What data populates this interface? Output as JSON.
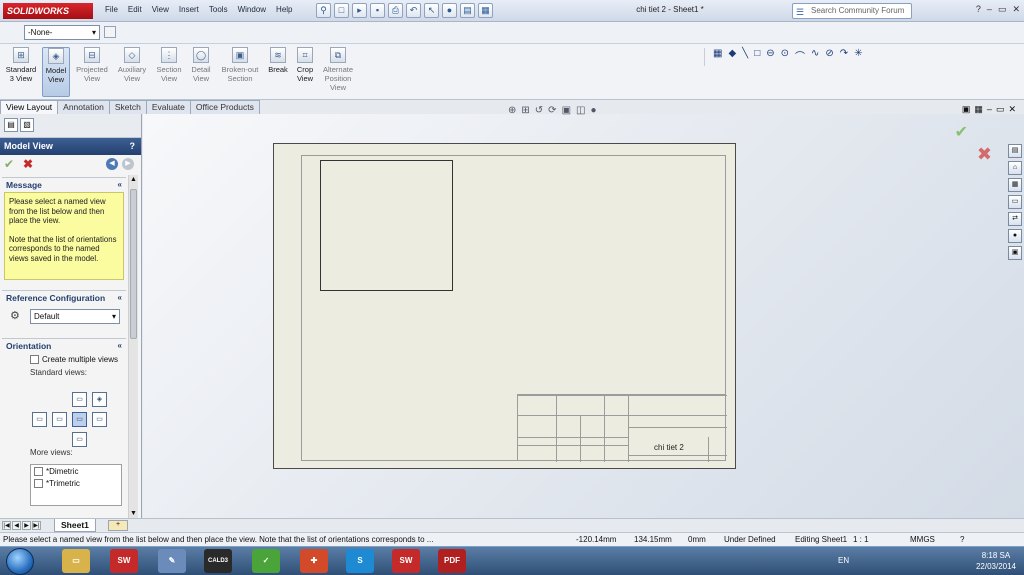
{
  "app": {
    "logo": "SOLIDWORKS",
    "title": "chi tiet 2 - Sheet1 *",
    "menu": [
      "File",
      "Edit",
      "View",
      "Insert",
      "Tools",
      "Window",
      "Help"
    ],
    "search_placeholder": "Search Community Forum",
    "window_controls": [
      "?",
      "–",
      "▭",
      "✕"
    ]
  },
  "config": {
    "value": "-None-"
  },
  "ribbon": {
    "buttons": [
      {
        "label": "Standard 3 View"
      },
      {
        "label": "Model View"
      },
      {
        "label": "Projected View"
      },
      {
        "label": "Auxiliary View"
      },
      {
        "label": "Section View"
      },
      {
        "label": "Detail View"
      },
      {
        "label": "Broken-out Section"
      },
      {
        "label": "Break"
      },
      {
        "label": "Crop View"
      },
      {
        "label": "Alternate Position View"
      }
    ]
  },
  "tabs": [
    "View Layout",
    "Annotation",
    "Sketch",
    "Evaluate",
    "Office Products"
  ],
  "panel": {
    "title": "Model View",
    "help": "?",
    "message_header": "Message",
    "message_p1": "Please select a named view from the list below and then place the view.",
    "message_p2": "Note that the list of orientations corresponds to the named views saved in the model.",
    "refconfig_header": "Reference Configuration",
    "refconfig_value": "Default",
    "orientation_header": "Orientation",
    "create_multiple": "Create multiple views",
    "standard_views": "Standard views:",
    "more_views": "More views:",
    "more_items": [
      "*Dimetric",
      "*Trimetric"
    ]
  },
  "sheet_tabs": {
    "current": "Sheet1"
  },
  "drawing": {
    "part_name": "chi tiet 2"
  },
  "status": {
    "message": "Please select a named view from the list below and then place the view.  Note that the list of orientations corresponds to ...",
    "x": "-120.14mm",
    "y": "134.15mm",
    "z": "0mm",
    "state": "Under Defined",
    "editing": "Editing Sheet1",
    "scale": "1 : 1",
    "units": "MMGS",
    "help": "?"
  },
  "taskbar": {
    "language": "EN",
    "time": "8:18 SA",
    "date": "22/03/2014",
    "apps": [
      "SW",
      "CALD3",
      "PDF"
    ]
  }
}
